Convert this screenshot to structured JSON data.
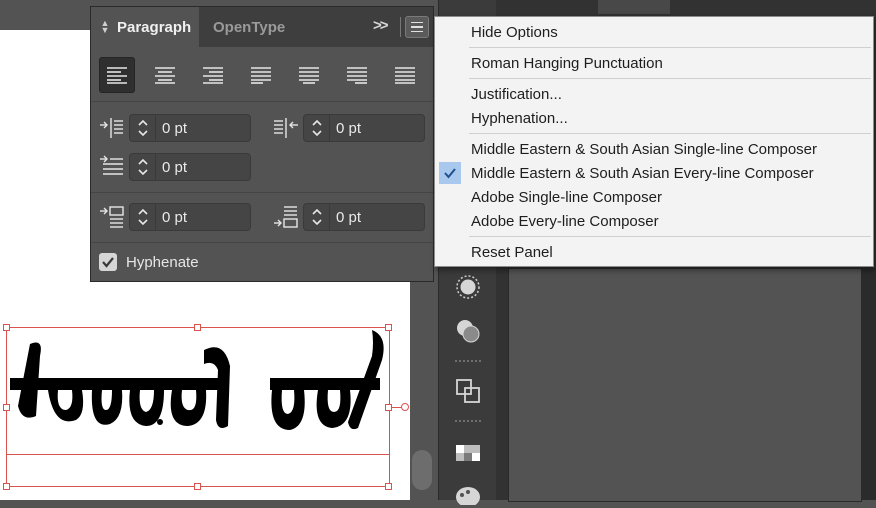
{
  "panel": {
    "tabs": [
      {
        "label": "Paragraph",
        "active": true
      },
      {
        "label": "OpenType",
        "active": false
      }
    ],
    "more_glyph": ">>",
    "alignments": [
      "align-left",
      "align-center",
      "align-right",
      "justify-last-left",
      "justify-last-center",
      "justify-last-right",
      "justify-all"
    ],
    "fields": {
      "left_indent": "0 pt",
      "right_indent": "0 pt",
      "first_line_indent": "0 pt",
      "space_before": "0 pt",
      "space_after": "0 pt"
    },
    "hyphenate": {
      "label": "Hyphenate",
      "checked": true
    }
  },
  "menu": {
    "items": [
      {
        "label": "Hide Options",
        "checked": false
      },
      {
        "label": "Roman Hanging Punctuation",
        "checked": false
      },
      {
        "label": "Justification...",
        "checked": false
      },
      {
        "label": "Hyphenation...",
        "checked": false
      },
      {
        "label": "Middle Eastern & South Asian Single-line Composer",
        "checked": false
      },
      {
        "label": "Middle Eastern & South Asian Every-line Composer",
        "checked": true
      },
      {
        "label": "Adobe Single-line Composer",
        "checked": false
      },
      {
        "label": "Adobe Every-line Composer",
        "checked": false
      },
      {
        "label": "Reset Panel",
        "checked": false
      }
    ]
  },
  "artboard": {
    "text_object": "selected-text-frame"
  },
  "colors": {
    "panel_bg": "#535353",
    "menu_bg": "#f3f3f3",
    "selection": "#d9534f",
    "check_highlight": "#a8c8ee"
  }
}
